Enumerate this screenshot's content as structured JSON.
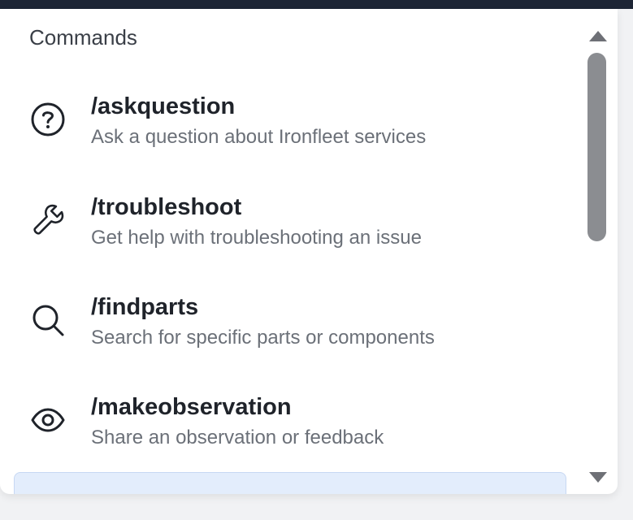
{
  "header": {
    "title": "Commands"
  },
  "commands": [
    {
      "name": "/askquestion",
      "description": "Ask a question about Ironfleet services",
      "icon": "question-circle-icon"
    },
    {
      "name": "/troubleshoot",
      "description": "Get help with troubleshooting an issue",
      "icon": "wrench-icon"
    },
    {
      "name": "/findparts",
      "description": "Search for specific parts or components",
      "icon": "search-icon"
    },
    {
      "name": "/makeobservation",
      "description": "Share an observation or feedback",
      "icon": "eye-icon"
    }
  ],
  "scrollbar": {
    "up_icon": "scroll-up-arrow-icon",
    "down_icon": "scroll-down-arrow-icon"
  },
  "colors": {
    "topbar": "#1d2535",
    "highlight": "#e3edfc",
    "text_primary": "#1f232a",
    "text_secondary": "#6b7078"
  }
}
